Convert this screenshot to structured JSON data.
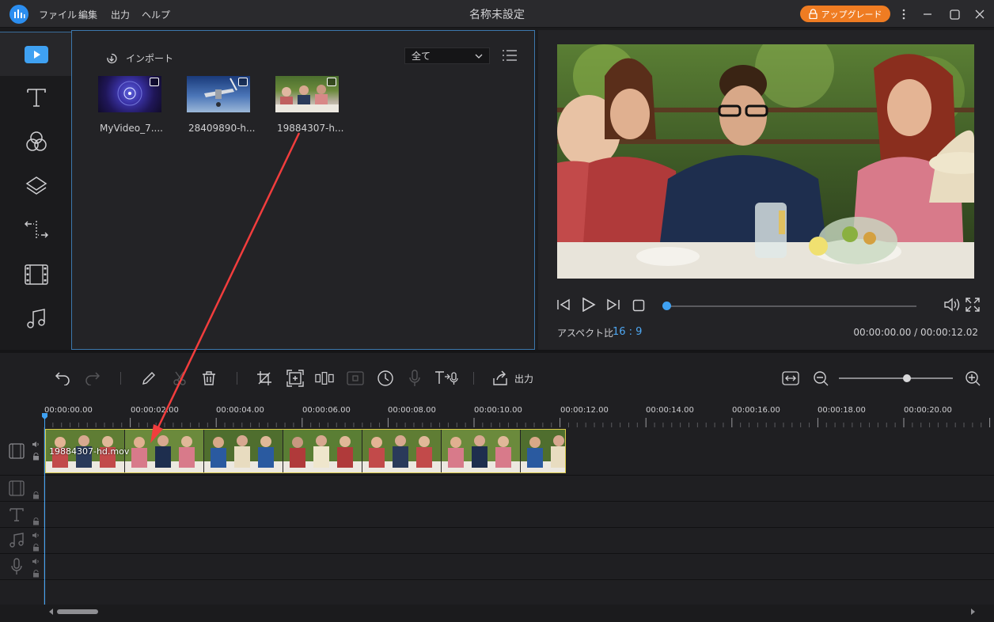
{
  "app": {
    "title": "名称未設定",
    "menu": [
      "ファイル",
      "編集",
      "出力",
      "ヘルプ"
    ],
    "upgrade_label": "アップグレード"
  },
  "media": {
    "import_label": "インポート",
    "filter": "全て",
    "items": [
      {
        "name": "MyVideo_7...."
      },
      {
        "name": "28409890-h..."
      },
      {
        "name": "19884307-h..."
      }
    ]
  },
  "preview": {
    "aspect_label": "アスペクト比",
    "aspect_value": "16 : 9",
    "timecode": "00:00:00.00 / 00:00:12.02",
    "progress": 0
  },
  "timeline": {
    "export_label": "出力",
    "ruler": [
      "00:00:00.00",
      "00:00:02.00",
      "00:00:04.00",
      "00:00:06.00",
      "00:00:08.00",
      "00:00:10.00",
      "00:00:12.00",
      "00:00:14.00",
      "00:00:16.00",
      "00:00:18.00",
      "00:00:20.00"
    ],
    "clip_name": "19884307-hd.mov",
    "zoom": 0.56
  },
  "colors": {
    "accent": "#3fa1f2",
    "upgrade": "#ef7c22",
    "arrow": "#f23d3d",
    "clip_border": "#d9c94a"
  }
}
